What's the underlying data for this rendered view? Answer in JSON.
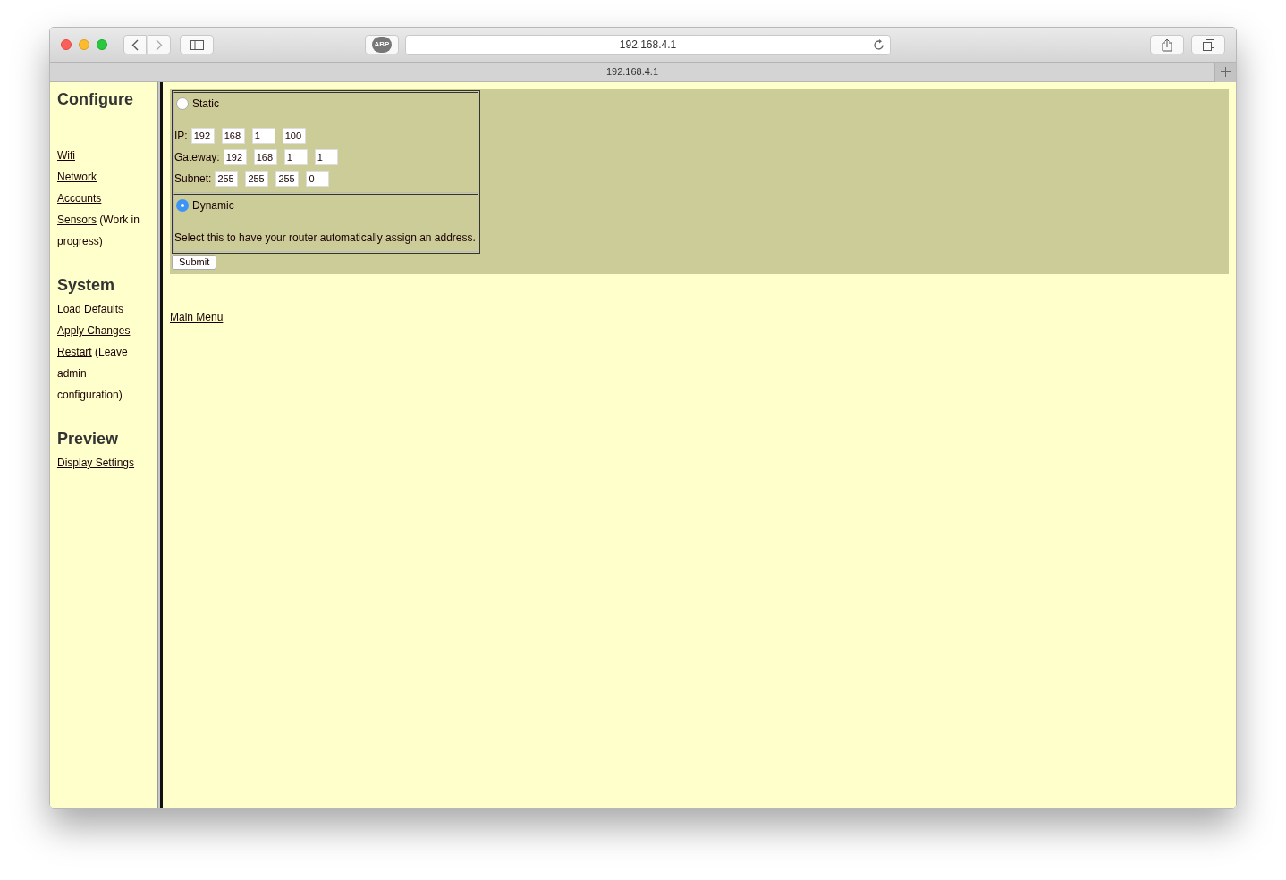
{
  "browser": {
    "extension_badge": "ABP",
    "url": "192.168.4.1",
    "tab_title": "192.168.4.1"
  },
  "sidebar": [
    {
      "heading": "Configure",
      "items": [
        {
          "link": "Wifi"
        },
        {
          "link": "Network"
        },
        {
          "link": "Accounts"
        },
        {
          "link": "Sensors",
          "note": "(Work in progress)"
        }
      ]
    },
    {
      "heading": "System",
      "items": [
        {
          "link": "Load Defaults"
        },
        {
          "link": "Apply Changes"
        },
        {
          "link": "Restart",
          "note": "(Leave admin configuration)"
        }
      ]
    },
    {
      "heading": "Preview",
      "items": [
        {
          "link": "Display Settings"
        }
      ]
    }
  ],
  "address_options": [
    {
      "kind": "static",
      "label": "Static",
      "selected": false,
      "rows": [
        {
          "label": "IP:",
          "values": [
            "192",
            "168",
            "1",
            "100"
          ]
        },
        {
          "label": "Gateway:",
          "values": [
            "192",
            "168",
            "1",
            "1"
          ]
        },
        {
          "label": "Subnet:",
          "values": [
            "255",
            "255",
            "255",
            "0"
          ]
        }
      ]
    },
    {
      "kind": "dynamic",
      "label": "Dynamic",
      "selected": true,
      "description": "Select this to have your router automatically assign an address."
    }
  ],
  "submit": "Submit",
  "footer_link": "Main Menu"
}
